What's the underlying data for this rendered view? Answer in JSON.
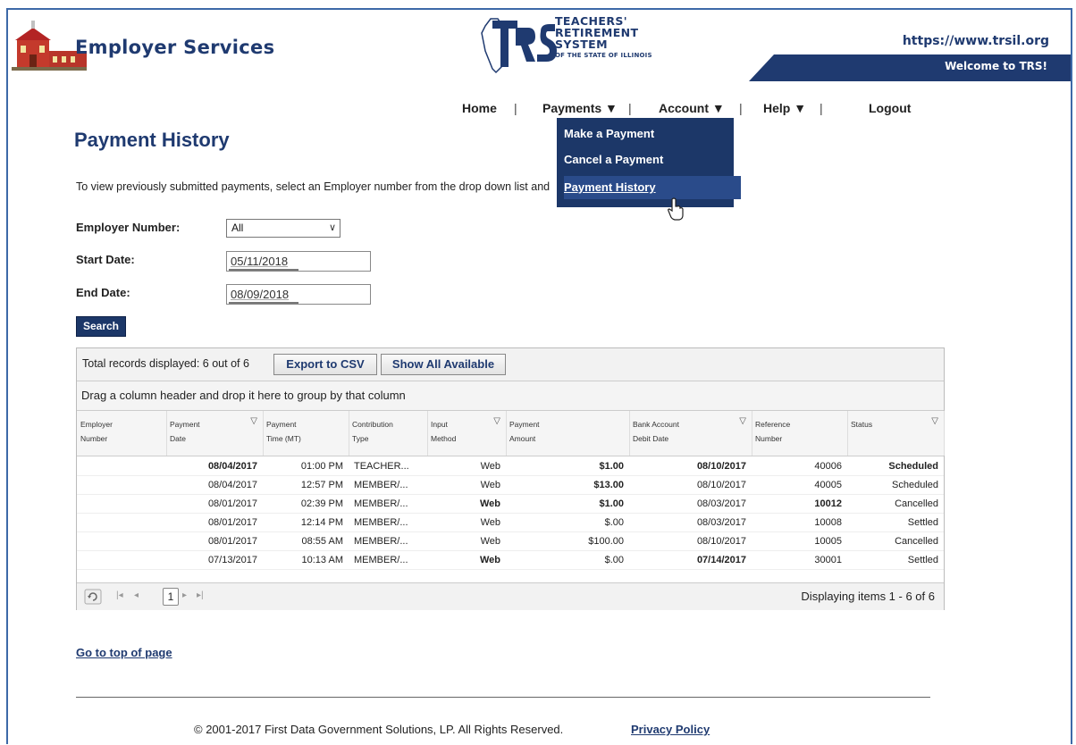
{
  "header": {
    "brand_title": "Employer Services",
    "trs_line1": "TEACHERS'",
    "trs_line2": "RETIREMENT",
    "trs_line3": "SYSTEM",
    "trs_line4": "OF THE STATE OF ILLINOIS",
    "site_url": "https://www.trsil.org",
    "welcome": "Welcome to TRS!",
    "brand_color": "#1f3a70"
  },
  "nav": {
    "home": "Home",
    "payments": "Payments ▼",
    "account": "Account ▼",
    "help": "Help ▼",
    "logout": "Logout",
    "sep": "|"
  },
  "dropdown": {
    "items": [
      "Make a Payment",
      "Cancel a Payment",
      "Payment History"
    ],
    "active_index": 2
  },
  "page": {
    "title": "Payment History",
    "intro": "To view previously submitted payments, select an Employer number from the drop down list and click Search."
  },
  "form": {
    "employer_label": "Employer Number:",
    "employer_value": "All",
    "start_label": "Start Date:",
    "start_value": "05/11/2018",
    "end_label": "End Date:",
    "end_value": "08/09/2018",
    "search": "Search"
  },
  "grid": {
    "records": "Total records displayed: 6 out of 6",
    "export": "Export to CSV",
    "show_all": "Show All Available",
    "group_hint": "Drag a column header and drop it here to group by that column",
    "columns": [
      {
        "l1": "Employer",
        "l2": "Number",
        "filter": false
      },
      {
        "l1": "Payment",
        "l2": "Date",
        "filter": true
      },
      {
        "l1": "Payment",
        "l2": "Time (MT)",
        "filter": false
      },
      {
        "l1": "Contribution",
        "l2": "Type",
        "filter": false
      },
      {
        "l1": "Input",
        "l2": "Method",
        "filter": true
      },
      {
        "l1": "Payment",
        "l2": "Amount",
        "filter": false
      },
      {
        "l1": "Bank Account",
        "l2": "Debit Date",
        "filter": true
      },
      {
        "l1": "Reference",
        "l2": "Number",
        "filter": false
      },
      {
        "l1": "Status",
        "l2": "",
        "filter": true
      }
    ],
    "rows": [
      [
        "",
        "08/04/2017",
        "01:00 PM",
        "TEACHER...",
        "Web",
        "$1.00",
        "08/10/2017",
        "40006",
        "Scheduled"
      ],
      [
        "",
        "08/04/2017",
        "12:57 PM",
        "MEMBER/...",
        "Web",
        "$13.00",
        "08/10/2017",
        "40005",
        "Scheduled"
      ],
      [
        "",
        "08/01/2017",
        "02:39 PM",
        "MEMBER/...",
        "Web",
        "$1.00",
        "08/03/2017",
        "10012",
        "Cancelled"
      ],
      [
        "",
        "08/01/2017",
        "12:14 PM",
        "MEMBER/...",
        "Web",
        "$.00",
        "08/03/2017",
        "10008",
        "Settled"
      ],
      [
        "",
        "08/01/2017",
        "08:55 AM",
        "MEMBER/...",
        "Web",
        "$100.00",
        "08/10/2017",
        "10005",
        "Cancelled"
      ],
      [
        "",
        "07/13/2017",
        "10:13 AM",
        "MEMBER/...",
        "Web",
        "$.00",
        "07/14/2017",
        "30001",
        "Settled"
      ]
    ],
    "page_number": "1",
    "displaying": "Displaying items 1 - 6 of 6"
  },
  "footer": {
    "top_link": "Go to top of page",
    "copyright": "© 2001-2017 First Data Government Solutions, LP. All Rights Reserved.",
    "privacy": "Privacy Policy"
  },
  "icons": {
    "refresh": "refresh-icon",
    "filter": "filter-icon",
    "first_page": "first-page-icon",
    "prev_page": "prev-page-icon",
    "next_page": "next-page-icon",
    "last_page": "last-page-icon"
  }
}
